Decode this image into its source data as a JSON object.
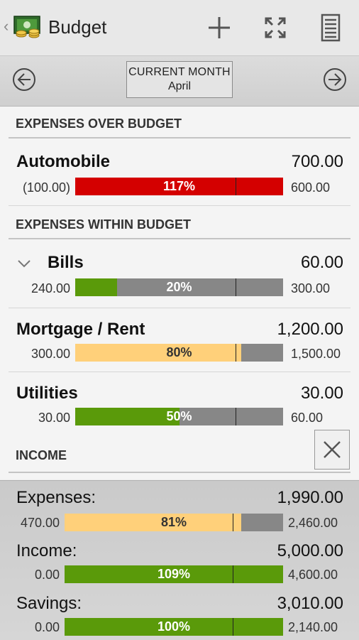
{
  "header": {
    "title": "Budget"
  },
  "month": {
    "label": "CURRENT MONTH",
    "value": "April"
  },
  "sections": {
    "over_budget": "EXPENSES OVER BUDGET",
    "within_budget": "EXPENSES WITHIN BUDGET",
    "income": "INCOME"
  },
  "rows": [
    {
      "name": "Automobile",
      "amount": "700.00",
      "left": "(100.00)",
      "right": "600.00",
      "pct_label": "117%",
      "fill": 1.0,
      "fill_color": "#d40000",
      "text_color": "#ffffff",
      "marker": 0.77,
      "expandable": false
    },
    {
      "name": "Bills",
      "amount": "60.00",
      "left": "240.00",
      "right": "300.00",
      "pct_label": "20%",
      "fill": 0.2,
      "fill_color": "#5a9a0a",
      "text_color": "#ffffff",
      "marker": 0.77,
      "expandable": true
    },
    {
      "name": "Mortgage / Rent",
      "amount": "1,200.00",
      "left": "300.00",
      "right": "1,500.00",
      "pct_label": "80%",
      "fill": 0.8,
      "fill_color": "#ffd07a",
      "text_color": "#333333",
      "marker": 0.77,
      "expandable": false
    },
    {
      "name": "Utilities",
      "amount": "30.00",
      "left": "30.00",
      "right": "60.00",
      "pct_label": "50%",
      "fill": 0.5,
      "fill_color": "#5a9a0a",
      "text_color": "#ffffff",
      "marker": 0.77,
      "expandable": false
    }
  ],
  "summary": [
    {
      "name": "Expenses:",
      "amount": "1,990.00",
      "left": "470.00",
      "right": "2,460.00",
      "pct_label": "81%",
      "fill": 0.81,
      "fill_color": "#ffd07a",
      "text_color": "#333333",
      "marker": 0.77
    },
    {
      "name": "Income:",
      "amount": "5,000.00",
      "left": "0.00",
      "right": "4,600.00",
      "pct_label": "109%",
      "fill": 1.0,
      "fill_color": "#5a9a0a",
      "text_color": "#ffffff",
      "marker": 0.77
    },
    {
      "name": "Savings:",
      "amount": "3,010.00",
      "left": "0.00",
      "right": "2,140.00",
      "pct_label": "100%",
      "fill": 1.0,
      "fill_color": "#5a9a0a",
      "text_color": "#ffffff",
      "marker": 0.77
    }
  ],
  "icons": {
    "add": "plus-icon",
    "fullscreen": "expand-icon",
    "report": "list-icon",
    "prev": "arrow-left-circle-icon",
    "next": "arrow-right-circle-icon",
    "close": "close-icon"
  }
}
